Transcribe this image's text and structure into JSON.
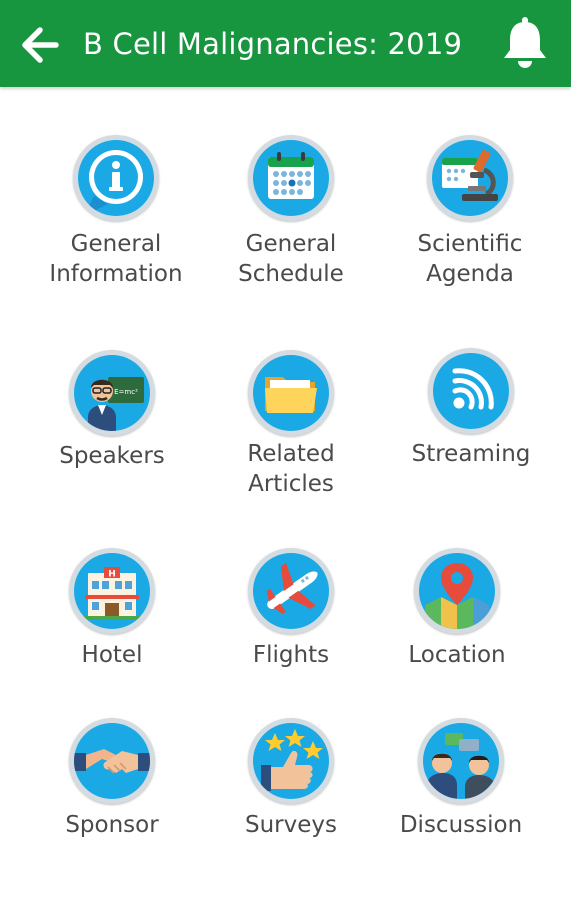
{
  "app_bar": {
    "title": "B Cell Malignancies: 2019",
    "background_color": "#17953f",
    "back_icon": "arrow-left-icon",
    "notification_icon": "bell-icon"
  },
  "menu": {
    "icon_background_color": "#1aa9e5",
    "items": [
      {
        "line1": "General",
        "line2": "Information",
        "icon": "info-icon"
      },
      {
        "line1": "General",
        "line2": "Schedule",
        "icon": "calendar-icon"
      },
      {
        "line1": "Scientific",
        "line2": "Agenda",
        "icon": "microscope-icon"
      },
      {
        "line1": "Speakers",
        "icon": "teacher-icon"
      },
      {
        "line1": "Related",
        "line2": "Articles",
        "icon": "folder-icon"
      },
      {
        "line1": "Streaming",
        "icon": "wifi-signal-icon"
      },
      {
        "line1": "Hotel",
        "icon": "hotel-building-icon"
      },
      {
        "line1": "Flights",
        "icon": "airplane-icon"
      },
      {
        "line1": "Location",
        "icon": "map-pin-icon"
      },
      {
        "line1": "Sponsor",
        "icon": "handshake-icon"
      },
      {
        "line1": "Surveys",
        "icon": "thumbs-up-stars-icon"
      },
      {
        "line1": "Discussion",
        "icon": "people-chat-icon"
      }
    ]
  }
}
